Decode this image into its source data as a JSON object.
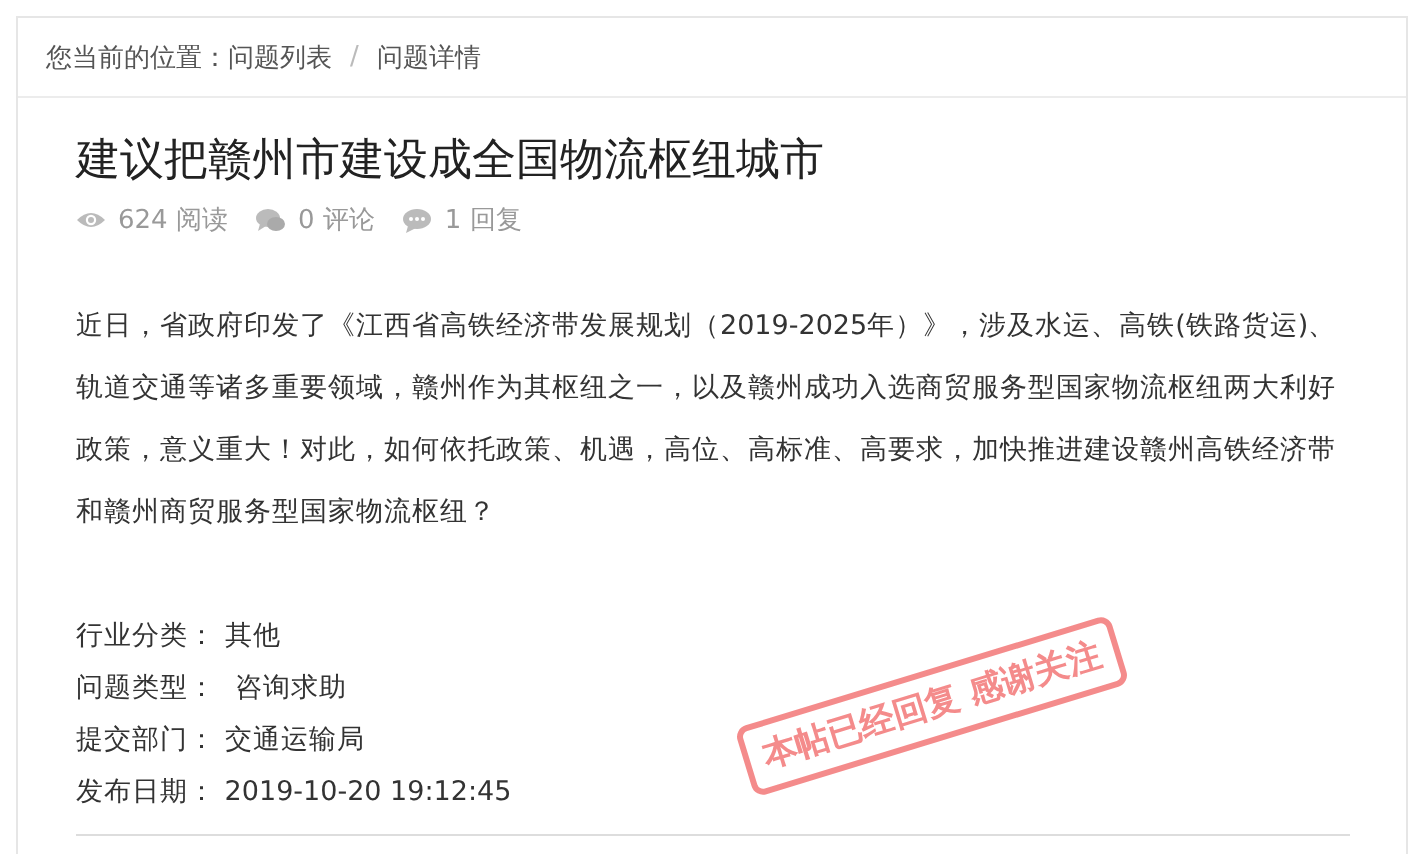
{
  "breadcrumb": {
    "label": "您当前的位置：",
    "items": [
      {
        "text": "问题列表"
      },
      {
        "text": "问题详情"
      }
    ],
    "separator": "/"
  },
  "title": "建议把赣州市建设成全国物流枢纽城市",
  "stats": [
    {
      "kind": "views",
      "text": "624 阅读"
    },
    {
      "kind": "comments",
      "text": "0 评论"
    },
    {
      "kind": "replies",
      "text": "1 回复"
    }
  ],
  "body": "近日，省政府印发了《江西省高铁经济带发展规划（2019-2025年）》，涉及水运、高铁(铁路货运)、轨道交通等诸多重要领域，赣州作为其枢纽之一，以及赣州成功入选商贸服务型国家物流枢纽两大利好政策，意义重大！对此，如何依托政策、机遇，高位、高标准、高要求，加快推进建设赣州高铁经济带和赣州商贸服务型国家物流枢纽？",
  "stamp": {
    "text": "本帖已经回复 感谢关注"
  },
  "fields": [
    {
      "label": "行业分类：",
      "value": "其他"
    },
    {
      "label": "问题类型：",
      "value": "咨询求助"
    },
    {
      "label": "提交部门：",
      "value": "交通运输局"
    },
    {
      "label": "发布日期：",
      "value": "2019-10-20 19:12:45"
    }
  ]
}
